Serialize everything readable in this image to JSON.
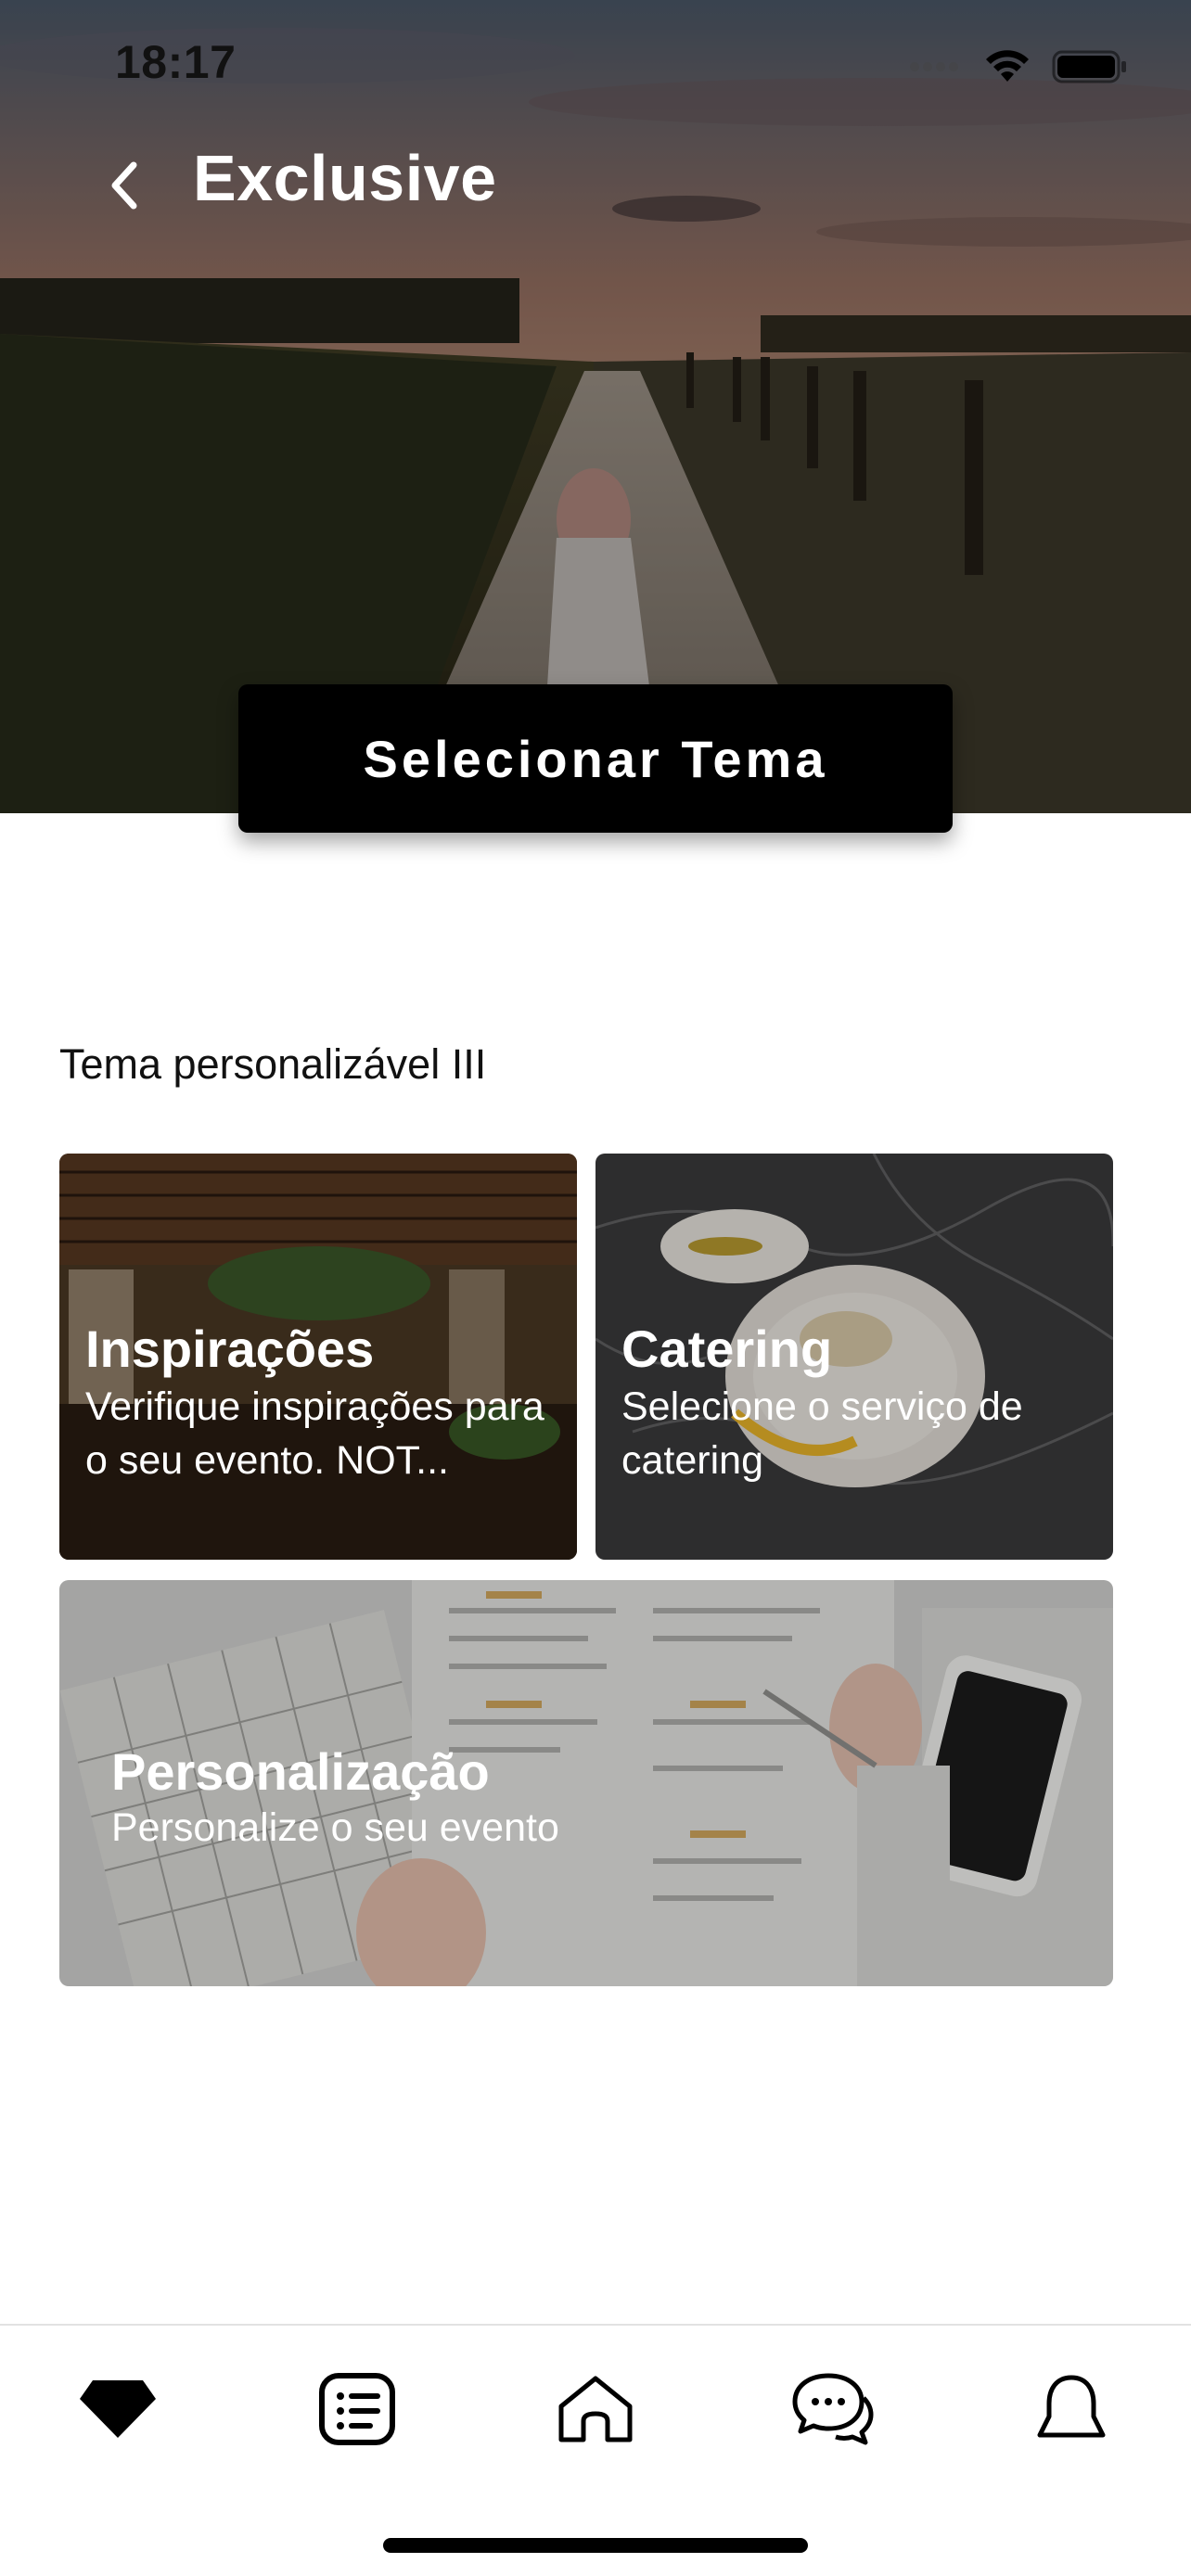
{
  "status_bar": {
    "time": "18:17"
  },
  "header": {
    "title": "Exclusive",
    "back_icon": "chevron-left-icon"
  },
  "hero": {
    "button_label": "Selecionar Tema"
  },
  "section": {
    "label": "Tema personalizável III"
  },
  "cards": [
    {
      "title": "Inspirações",
      "subtitle": "Verifique inspirações para o seu evento. NOT..."
    },
    {
      "title": "Catering",
      "subtitle": "Selecione o serviço de catering"
    },
    {
      "title": "Personalização",
      "subtitle": "Personalize o seu evento"
    }
  ],
  "tab_bar": {
    "items": [
      {
        "icon": "diamond-icon",
        "active": true
      },
      {
        "icon": "list-icon",
        "active": false
      },
      {
        "icon": "home-icon",
        "active": false
      },
      {
        "icon": "chat-bubbles-icon",
        "active": false
      },
      {
        "icon": "bell-icon",
        "active": false
      }
    ]
  },
  "colors": {
    "button_bg": "#000000",
    "title_text": "#ffffff",
    "body_text": "#111111",
    "divider": "#e2e2e2"
  }
}
